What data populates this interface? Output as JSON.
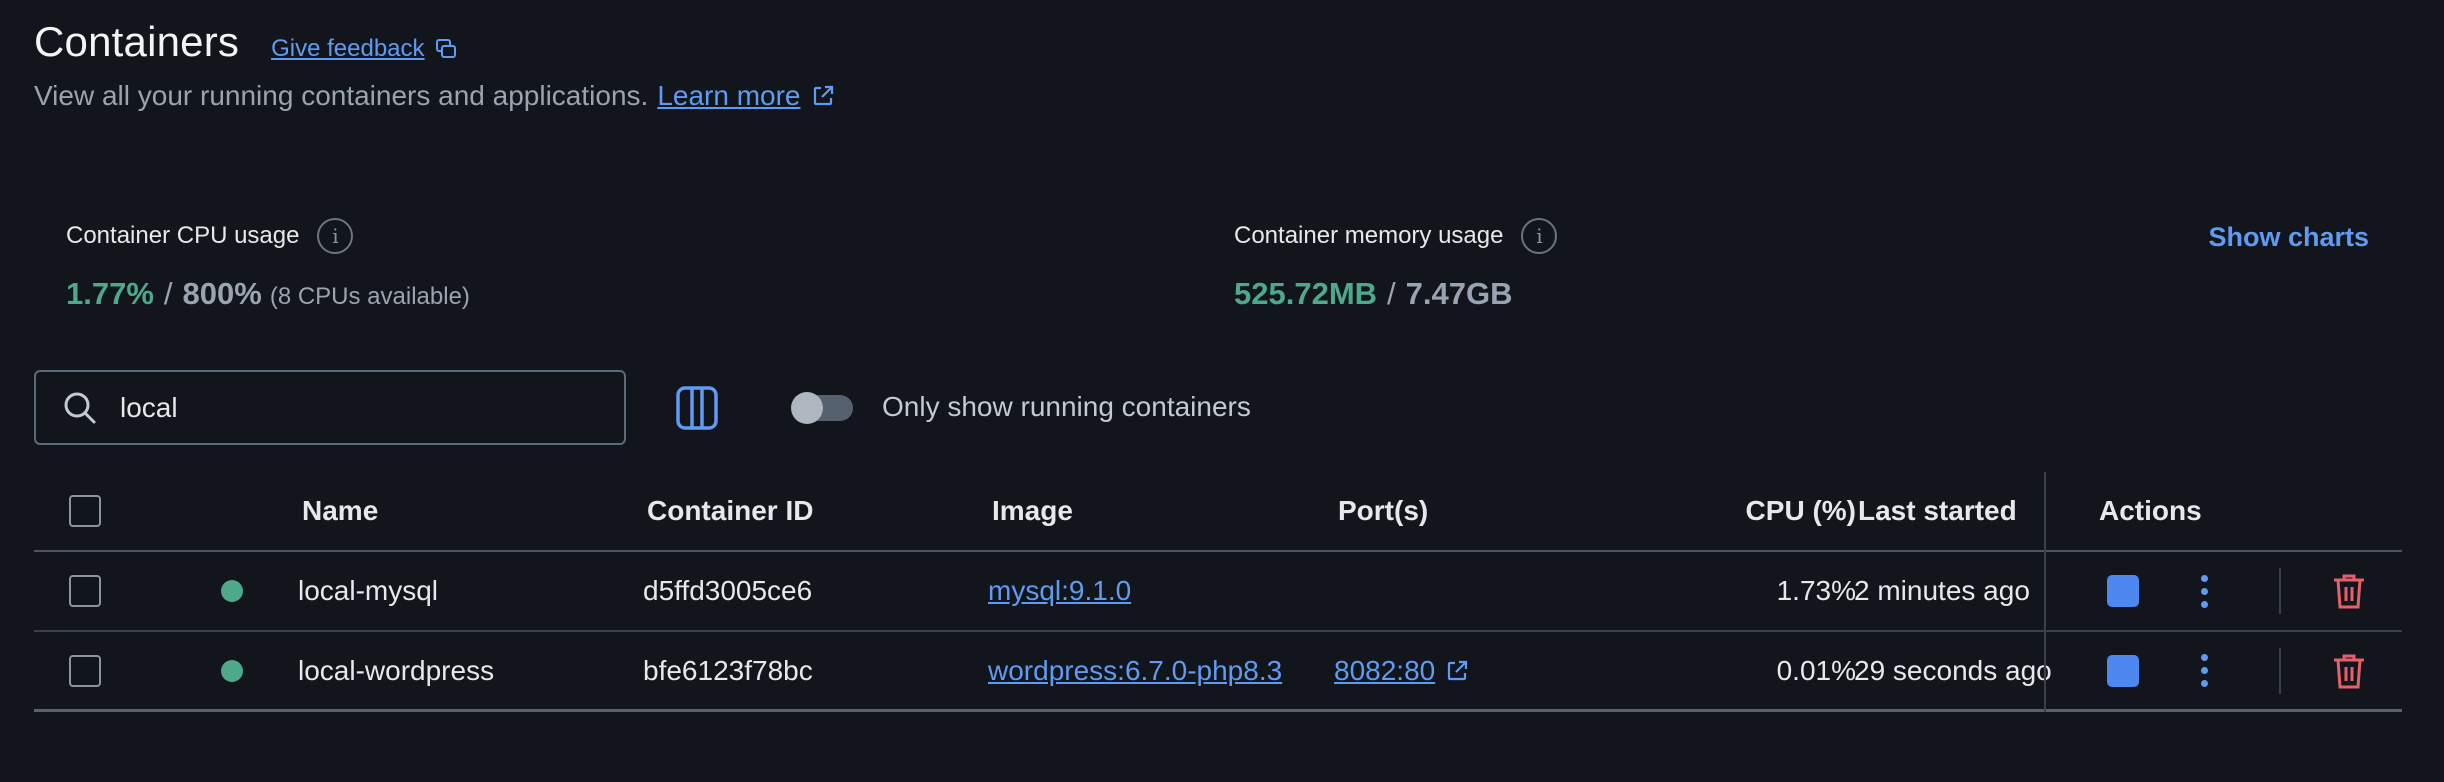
{
  "header": {
    "title": "Containers",
    "feedback_label": "Give feedback",
    "subtitle": "View all your running containers and applications.",
    "learn_more": "Learn more"
  },
  "stats": {
    "cpu": {
      "label": "Container CPU usage",
      "used": "1.77%",
      "total": "800%",
      "note": "(8 CPUs available)"
    },
    "memory": {
      "label": "Container memory usage",
      "used": "525.72MB",
      "total": "7.47GB"
    },
    "show_charts": "Show charts",
    "separator": "/"
  },
  "toolbar": {
    "search_value": "local",
    "toggle_label": "Only show running containers",
    "toggle_on": false
  },
  "table": {
    "columns": {
      "name": "Name",
      "container_id": "Container ID",
      "image": "Image",
      "ports": "Port(s)",
      "cpu": "CPU (%)",
      "last_started": "Last started",
      "actions": "Actions"
    },
    "rows": [
      {
        "status": "running",
        "name": "local-mysql",
        "container_id": "d5ffd3005ce6",
        "image": "mysql:9.1.0",
        "ports": "",
        "cpu": "1.73%",
        "last_started": "2 minutes ago"
      },
      {
        "status": "running",
        "name": "local-wordpress",
        "container_id": "bfe6123f78bc",
        "image": "wordpress:6.7.0-php8.3",
        "ports": "8082:80",
        "cpu": "0.01%",
        "last_started": "29 seconds ago"
      }
    ]
  },
  "colors": {
    "background": "#12161c",
    "accent": "#5f9bf2",
    "running": "#4ea98b",
    "danger": "#e5606a"
  }
}
